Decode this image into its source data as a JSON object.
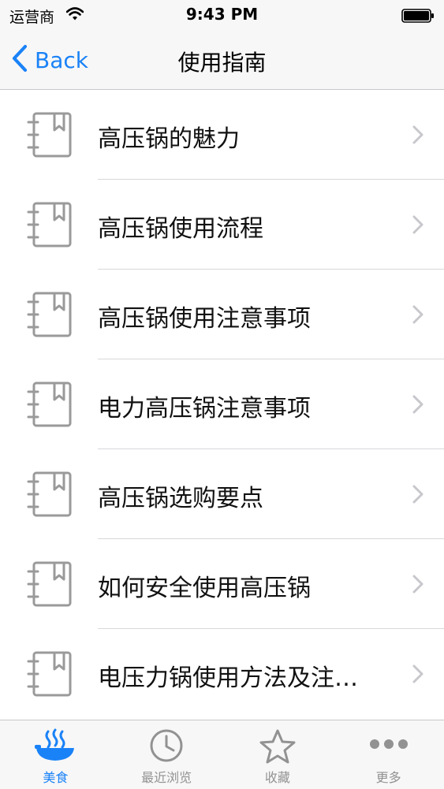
{
  "status_bar": {
    "carrier": "运营商",
    "time": "9:43 PM",
    "wifi_icon": "wifi-icon",
    "battery_icon": "battery-icon"
  },
  "nav_bar": {
    "back_label": "Back",
    "title": "使用指南"
  },
  "list": {
    "items": [
      {
        "label": "高压锅的魅力"
      },
      {
        "label": "高压锅使用流程"
      },
      {
        "label": "高压锅使用注意事项"
      },
      {
        "label": "电力高压锅注意事项"
      },
      {
        "label": "高压锅选购要点"
      },
      {
        "label": "如何安全使用高压锅"
      },
      {
        "label": "电压力锅使用方法及注…"
      }
    ],
    "item_icon": "notebook-icon"
  },
  "tab_bar": {
    "tabs": [
      {
        "label": "美食",
        "icon": "food-bowl-icon",
        "active": true
      },
      {
        "label": "最近浏览",
        "icon": "clock-icon",
        "active": false
      },
      {
        "label": "收藏",
        "icon": "star-icon",
        "active": false
      },
      {
        "label": "更多",
        "icon": "more-dots-icon",
        "active": false
      }
    ]
  },
  "colors": {
    "accent": "#1a82f7",
    "inactive": "#929292",
    "bar_background": "#f7f7f7",
    "separator": "#d8d8dc"
  }
}
